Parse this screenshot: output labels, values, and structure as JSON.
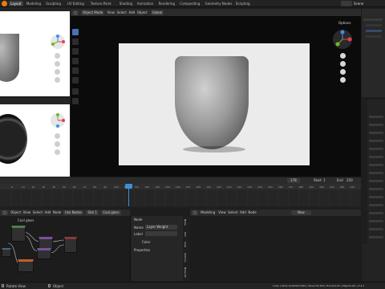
{
  "topbar": {
    "tabs": [
      "Layout",
      "Modeling",
      "Sculpting",
      "UV Editing",
      "Texture Paint",
      "Shading",
      "Animation",
      "Rendering",
      "Compositing",
      "Geometry Nodes",
      "Scripting"
    ],
    "active_tab": "Layout",
    "scene_label": "Scene"
  },
  "viewport_header": {
    "mode": "Object Mode",
    "menus": [
      "View",
      "Select",
      "Add",
      "Object"
    ],
    "transform": "Global",
    "options": "Options"
  },
  "timeline": {
    "current_frame": "178",
    "start_label": "Start",
    "start_value": "1",
    "end_label": "End",
    "end_value": "250",
    "ruler_marks": [
      "0",
      "10",
      "20",
      "30",
      "40",
      "50",
      "60",
      "70",
      "80",
      "90",
      "100",
      "110",
      "120",
      "130",
      "140",
      "150",
      "160",
      "170",
      "180",
      "190",
      "200",
      "210",
      "220",
      "230",
      "240",
      "250",
      "260",
      "270",
      "280",
      "290",
      "300",
      "310",
      "320",
      "330"
    ]
  },
  "shader_editor": {
    "header_items": [
      "Object",
      "View",
      "Select",
      "Add",
      "Node",
      "Use Nodes"
    ],
    "slot": "Slot 1",
    "material": "Cool glass"
  },
  "sidepanel": {
    "section": "Node",
    "name_label": "Name",
    "name_value": "Layer Weight",
    "label_label": "Label",
    "color_label": "Color",
    "properties_label": "Properties",
    "tabs": [
      "Node",
      "Tool",
      "View",
      "Options",
      "Node Wr"
    ]
  },
  "modeling_header": {
    "mode": "Modeling",
    "menus": [
      "View",
      "Select",
      "Add",
      "Node"
    ],
    "new_label": "New"
  },
  "statusbar": {
    "left": "Rotate View",
    "middle": "Object",
    "right": "Cube | Verts:14,634/14,634 | Faces:15,344 | Tris:29,122 | Objects:0/1 | 3.4.1"
  },
  "colors": {
    "accent": "#4772b3",
    "x_axis": "#e54054",
    "y_axis": "#70b82f",
    "z_axis": "#3e8fe5",
    "playhead": "#3f8ed4",
    "background": "#1d1d1d"
  }
}
